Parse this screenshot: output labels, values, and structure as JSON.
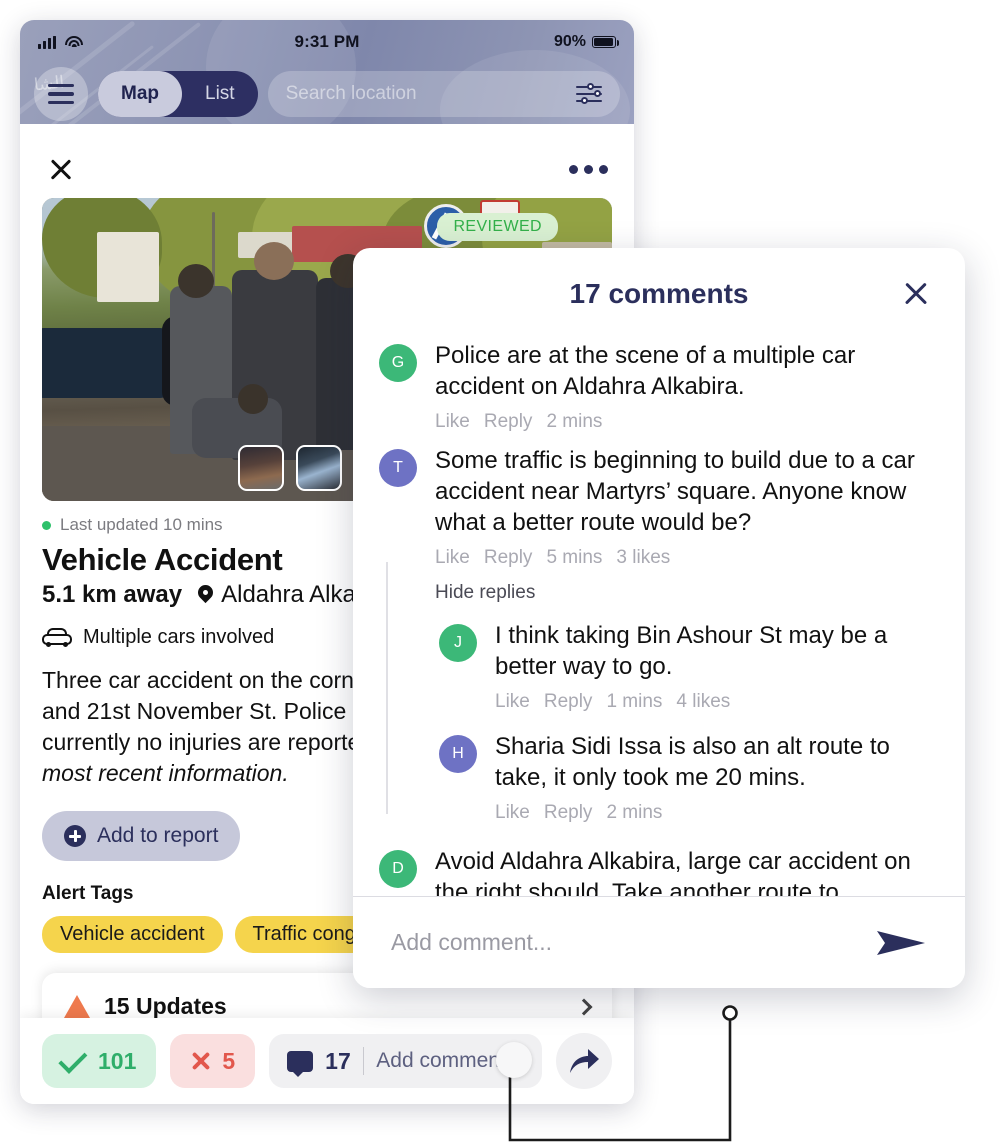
{
  "status_bar": {
    "time": "9:31 PM",
    "battery": "90%"
  },
  "toolbar": {
    "menu_icon": "hamburger-icon",
    "segment": {
      "map": "Map",
      "list": "List",
      "active": "Map"
    },
    "search_placeholder": "Search location",
    "filter_icon": "sliders-icon"
  },
  "report": {
    "close_icon": "close-icon",
    "more_icon": "more-options-icon",
    "reviewed_badge": "REVIEWED",
    "updated": "Last updated 10 mins",
    "title": "Vehicle Accident",
    "distance": "5.1 km away",
    "location": "Aldahra Alkabira",
    "detail": "Multiple cars involved",
    "description_plain": "Three car accident on the corner of Aldahra Alkabira and 21st November St. Police are on the scene, currently no injuries are reported. ",
    "description_italic": "Check back for the most recent information.",
    "add_to_report": "Add to report",
    "tags_heading": "Alert Tags",
    "tags": [
      "Vehicle accident",
      "Traffic congestion"
    ],
    "updates_label": "15 Updates"
  },
  "action_bar": {
    "confirm_count": "101",
    "deny_count": "5",
    "comment_count": "17",
    "comment_placeholder": "Add comment...",
    "share_icon": "share-icon"
  },
  "comments_panel": {
    "title": "17 comments",
    "close_icon": "close-icon",
    "input_placeholder": "Add comment...",
    "send_icon": "send-icon",
    "hide_replies": "Hide replies",
    "items": [
      {
        "avatar": "G",
        "avatar_color": "#3cb878",
        "text": "Police are at the scene of a multiple car accident on Aldahra Alkabira.",
        "like": "Like",
        "reply": "Reply",
        "time": "2 mins",
        "likes": ""
      },
      {
        "avatar": "T",
        "avatar_color": "#6e72c4",
        "text": "Some traffic is beginning to build due to a car accident near Martyrs’ square. Anyone know what a better route would be?",
        "like": "Like",
        "reply": "Reply",
        "time": "5 mins",
        "likes": "3 likes"
      },
      {
        "avatar": "J",
        "avatar_color": "#3cb878",
        "text": "I think taking Bin Ashour St may be a better way to go.",
        "like": "Like",
        "reply": "Reply",
        "time": "1 mins",
        "likes": "4 likes"
      },
      {
        "avatar": "H",
        "avatar_color": "#6e72c4",
        "text": "Sharia Sidi Issa is also an alt route to take, it only took me 20 mins.",
        "like": "Like",
        "reply": "Reply",
        "time": "2 mins",
        "likes": ""
      },
      {
        "avatar": "D",
        "avatar_color": "#3cb878",
        "text": "Avoid Aldahra Alkabira, large car accident on the right should. Take another route to",
        "like": "",
        "reply": "",
        "time": "",
        "likes": ""
      }
    ]
  },
  "colors": {
    "brand_navy": "#2b2f5c",
    "tag_yellow": "#f5d44c",
    "confirm_green": "#2fae6a",
    "deny_red": "#e2574c",
    "reviewed_green": "#33b04a"
  }
}
